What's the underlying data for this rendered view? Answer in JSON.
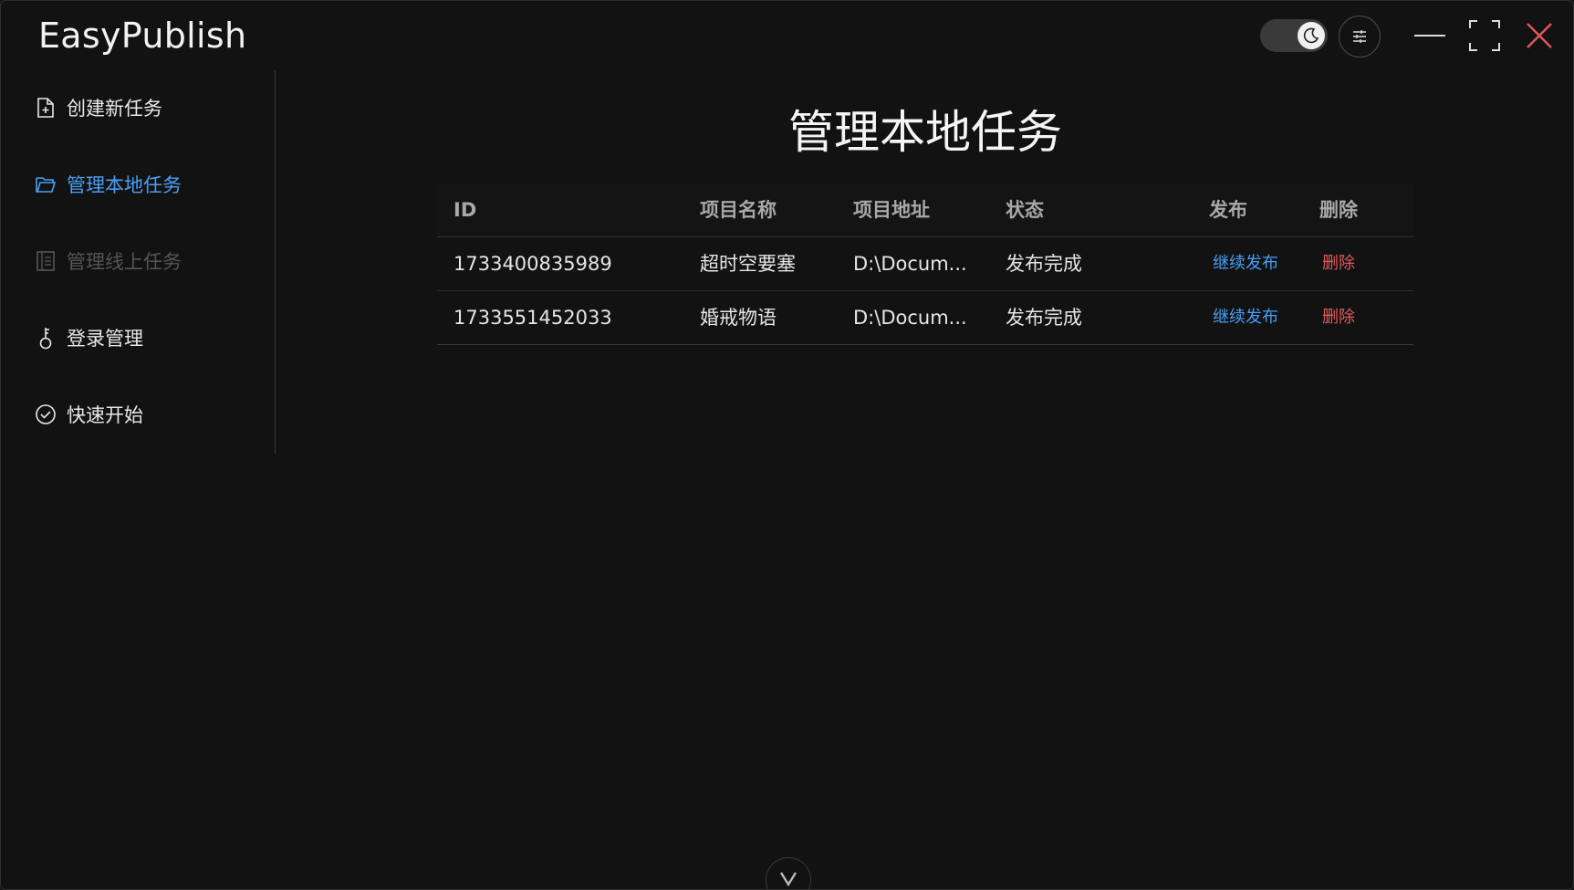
{
  "app": {
    "title": "EasyPublish"
  },
  "titlebar": {
    "theme_toggle": {
      "state": "dark",
      "icon": "moon-icon"
    },
    "settings_icon": "sliders-icon",
    "minimize_icon": "minimize-icon",
    "maximize_icon": "maximize-icon",
    "close_icon": "close-icon",
    "close_color": "#e05a5a"
  },
  "sidebar": {
    "items": [
      {
        "label": "创建新任务",
        "icon": "file-plus-icon",
        "state": "normal"
      },
      {
        "label": "管理本地任务",
        "icon": "folder-open-icon",
        "state": "active"
      },
      {
        "label": "管理线上任务",
        "icon": "list-icon",
        "state": "disabled"
      },
      {
        "label": "登录管理",
        "icon": "key-icon",
        "state": "normal"
      },
      {
        "label": "快速开始",
        "icon": "check-circle-icon",
        "state": "normal"
      }
    ]
  },
  "main": {
    "title": "管理本地任务",
    "table": {
      "columns": [
        "ID",
        "项目名称",
        "项目地址",
        "状态",
        "发布",
        "删除"
      ],
      "rows": [
        {
          "id": "1733400835989",
          "name": "超时空要塞",
          "path": "D:\\Docum...",
          "status": "发布完成",
          "publish": "继续发布",
          "delete": "删除"
        },
        {
          "id": "1733551452033",
          "name": "婚戒物语",
          "path": "D:\\Docum...",
          "status": "发布完成",
          "publish": "继续发布",
          "delete": "删除"
        }
      ]
    }
  },
  "colors": {
    "accent": "#4a9ff5",
    "danger": "#e05a5a",
    "background": "#121212"
  }
}
